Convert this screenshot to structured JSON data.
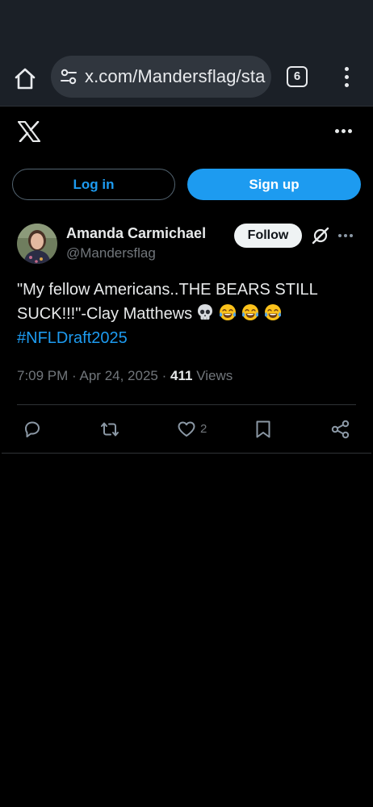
{
  "browser": {
    "url": "x.com/Mandersflag/sta",
    "tab_count": "6"
  },
  "auth": {
    "login_label": "Log in",
    "signup_label": "Sign up"
  },
  "tweet": {
    "author_name": "Amanda Carmichael",
    "author_handle": "@Mandersflag",
    "follow_label": "Follow",
    "text_line1": "\"My fellow Americans..THE BEARS STILL",
    "text_line2": "SUCK!!!\"-Clay Matthews",
    "emojis": [
      "skull-emoji",
      "tears-of-joy-emoji",
      "tears-of-joy-emoji",
      "tears-of-joy-emoji"
    ],
    "hashtag": "#NFLDraft2025",
    "time": "7:09 PM",
    "date": "Apr 24, 2025",
    "separator": "·",
    "views_count": "411",
    "views_label": "Views",
    "like_count": "2"
  },
  "colors": {
    "accent": "#1d9bf0",
    "background": "#000000",
    "browser_chrome": "#1b2027",
    "secondary_text": "#71767b"
  }
}
